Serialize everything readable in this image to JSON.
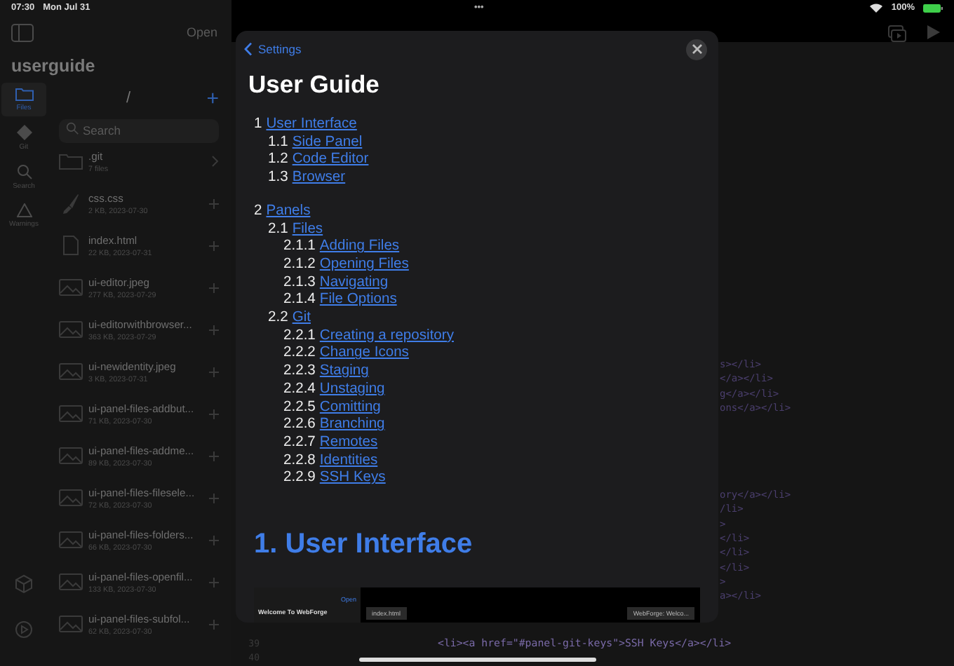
{
  "status_bar": {
    "time": "07:30",
    "date": "Mon Jul 31",
    "dots": "•••",
    "battery": "100%"
  },
  "sidebar": {
    "open_button": {
      "label": "Open",
      "disabled": true
    },
    "project": "userguide",
    "rail": [
      {
        "kind": "files",
        "label": "Files",
        "selected": true
      },
      {
        "kind": "git",
        "label": "Git",
        "selected": false
      },
      {
        "kind": "search",
        "label": "Search",
        "selected": false
      },
      {
        "kind": "warnings",
        "label": "Warnings",
        "selected": false
      }
    ],
    "path": "/",
    "add": "+",
    "search": {
      "placeholder": "Search"
    },
    "files": [
      {
        "kind": "folder",
        "name": ".git",
        "meta": "7 files"
      },
      {
        "kind": "css",
        "name": "css.css",
        "meta": "2 KB, 2023-07-30"
      },
      {
        "kind": "html",
        "name": "index.html",
        "meta": "22 KB, 2023-07-31"
      },
      {
        "kind": "image",
        "name": "ui-editor.jpeg",
        "meta": "277 KB, 2023-07-29"
      },
      {
        "kind": "image",
        "name": "ui-editorwithbrowser...",
        "meta": "363 KB, 2023-07-29"
      },
      {
        "kind": "image",
        "name": "ui-newidentity.jpeg",
        "meta": "3 KB, 2023-07-31"
      },
      {
        "kind": "image",
        "name": "ui-panel-files-addbut...",
        "meta": "71 KB, 2023-07-30"
      },
      {
        "kind": "image",
        "name": "ui-panel-files-addme...",
        "meta": "89 KB, 2023-07-30"
      },
      {
        "kind": "image",
        "name": "ui-panel-files-filesele...",
        "meta": "72 KB, 2023-07-30"
      },
      {
        "kind": "image",
        "name": "ui-panel-files-folders...",
        "meta": "66 KB, 2023-07-30"
      },
      {
        "kind": "image",
        "name": "ui-panel-files-openfil...",
        "meta": "133 KB, 2023-07-30"
      },
      {
        "kind": "image",
        "name": "ui-panel-files-subfol...",
        "meta": "62 KB, 2023-07-30"
      }
    ]
  },
  "editor": {
    "code_fragments": [
      [
        "s></li>",
        "</a></li>",
        "g</a></li>",
        "ons</a></li>"
      ],
      [
        "ory</a></li>",
        "/li>",
        ">",
        "</li>",
        "</li>",
        "</li>",
        ">",
        "a></li>"
      ]
    ],
    "code_lines": [
      {
        "number": "39",
        "text": "<li><a href=\"#panel-git-keys\">SSH Keys</a></li>"
      },
      {
        "number": "40"
      }
    ]
  },
  "modal": {
    "back": "Settings",
    "title": "User Guide",
    "toc": [
      {
        "number": "1",
        "title": "User Interface",
        "children": [
          {
            "number": "1.1",
            "title": "Side Panel"
          },
          {
            "number": "1.2",
            "title": "Code Editor"
          },
          {
            "number": "1.3",
            "title": "Browser"
          }
        ]
      },
      {
        "number": "2",
        "title": "Panels",
        "children": [
          {
            "number": "2.1",
            "title": "Files",
            "children": [
              {
                "number": "2.1.1",
                "title": "Adding Files"
              },
              {
                "number": "2.1.2",
                "title": "Opening Files"
              },
              {
                "number": "2.1.3",
                "title": "Navigating"
              },
              {
                "number": "2.1.4",
                "title": "File Options"
              }
            ]
          },
          {
            "number": "2.2",
            "title": "Git",
            "children": [
              {
                "number": "2.2.1",
                "title": "Creating a repository"
              },
              {
                "number": "2.2.2",
                "title": "Change Icons"
              },
              {
                "number": "2.2.3",
                "title": "Staging"
              },
              {
                "number": "2.2.4",
                "title": "Unstaging"
              },
              {
                "number": "2.2.5",
                "title": "Comitting"
              },
              {
                "number": "2.2.6",
                "title": "Branching"
              },
              {
                "number": "2.2.7",
                "title": "Remotes"
              },
              {
                "number": "2.2.8",
                "title": "Identities"
              },
              {
                "number": "2.2.9",
                "title": "SSH Keys"
              }
            ]
          }
        ]
      }
    ],
    "section_heading": "1. User Interface",
    "screenshot": {
      "welcome": "Welcome To WebForge",
      "open": "Open",
      "tab": "index.html",
      "browser_tab": "WebForge: Welco..."
    }
  }
}
